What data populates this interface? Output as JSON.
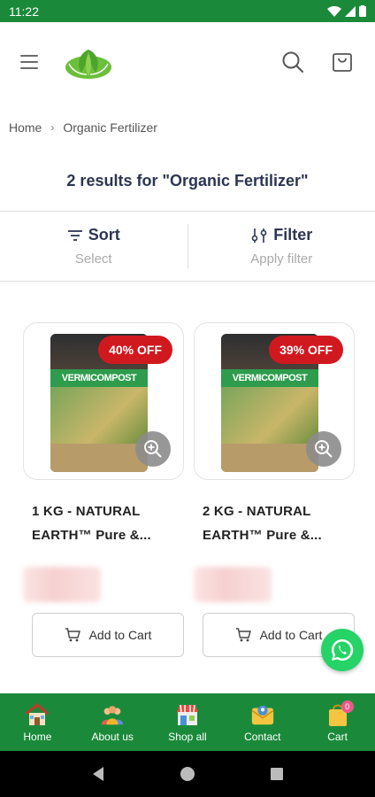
{
  "status_bar": {
    "time": "11:22"
  },
  "header": {
    "menu_icon": "hamburger-icon",
    "search_icon": "search-icon",
    "cart_icon": "shopping-bag-icon"
  },
  "breadcrumb": {
    "home": "Home",
    "separator": "›",
    "current": "Organic Fertilizer"
  },
  "results": {
    "title": "2 results for \"Organic Fertilizer\""
  },
  "sort": {
    "label": "Sort",
    "sub": "Select"
  },
  "filter": {
    "label": "Filter",
    "sub": "Apply filter"
  },
  "products": [
    {
      "title_line1": "1 KG - NATURAL",
      "title_line2": "EARTH™ Pure &...",
      "discount": "40% OFF",
      "bag_label": "VERMICOMPOST",
      "add_to_cart": "Add to Cart"
    },
    {
      "title_line1": "2 KG - NATURAL",
      "title_line2": "EARTH™ Pure &...",
      "discount": "39% OFF",
      "bag_label": "VERMICOMPOST",
      "add_to_cart": "Add to Cart"
    }
  ],
  "bottom_nav": [
    {
      "label": "Home",
      "icon": "home-icon"
    },
    {
      "label": "About us",
      "icon": "people-icon"
    },
    {
      "label": "Shop all",
      "icon": "store-icon"
    },
    {
      "label": "Contact",
      "icon": "contact-icon"
    },
    {
      "label": "Cart",
      "icon": "cart-icon",
      "badge": "0"
    }
  ],
  "colors": {
    "brand_green": "#1a8a3a",
    "discount_red": "#d0191f",
    "title_navy": "#2c3652",
    "whatsapp_green": "#25d366"
  }
}
